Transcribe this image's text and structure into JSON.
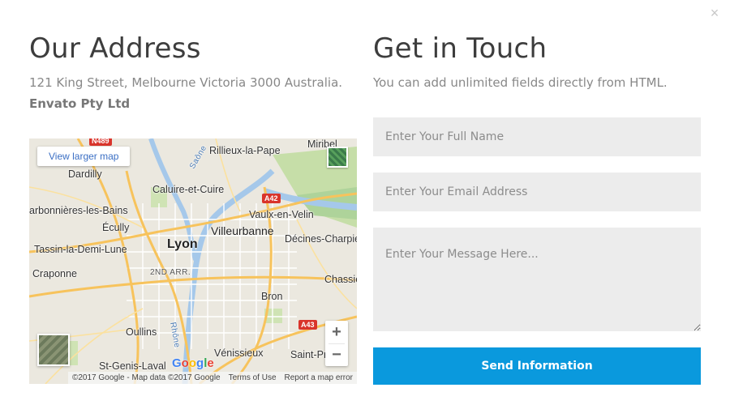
{
  "modal": {
    "close_glyph": "×"
  },
  "address": {
    "heading": "Our Address",
    "street": "121 King Street, Melbourne Victoria 3000 Australia.",
    "company": "Envato Pty Ltd"
  },
  "map": {
    "larger_map_link": "View larger map",
    "zoom_in": "+",
    "zoom_out": "−",
    "google_logo": "Google",
    "attribution": {
      "copyright": "©2017 Google - Map data ©2017 Google",
      "terms": "Terms of Use",
      "report": "Report a map error"
    },
    "labels": {
      "rillieux": "Rillieux-la-Pape",
      "miribel": "Miribel",
      "caluire": "Caluire-et-Cuire",
      "dardilly": "Dardilly",
      "charbonnieres": "arbonnières-les-Bains",
      "ecully": "Écully",
      "vaulx": "Vaulx-en-Velin",
      "lyon": "Lyon",
      "villeurbanne": "Villeurbanne",
      "decines": "Décines-Charpie",
      "tassin": "Tassin-la-Demi-Lune",
      "arr2": "2ND ARR.",
      "craponne": "Craponne",
      "chassieu": "Chassie",
      "bron": "Bron",
      "oullins": "Oullins",
      "genis": "St-Genis-Laval",
      "venissieux": "Vénissieux",
      "saintpri": "Saint-Pri",
      "rhone": "Rhône",
      "saone": "Saône"
    },
    "shields": {
      "a42": "A42",
      "a43": "A43",
      "n489": "N489"
    }
  },
  "contact": {
    "heading": "Get in Touch",
    "subtext": "You can add unlimited fields directly from HTML.",
    "name_placeholder": "Enter Your Full Name",
    "email_placeholder": "Enter Your Email Address",
    "message_placeholder": "Enter Your Message Here...",
    "submit_label": "Send Information"
  },
  "colors": {
    "accent": "#0a99dd",
    "field_bg": "#ececec",
    "heading": "#3d3d3d"
  }
}
